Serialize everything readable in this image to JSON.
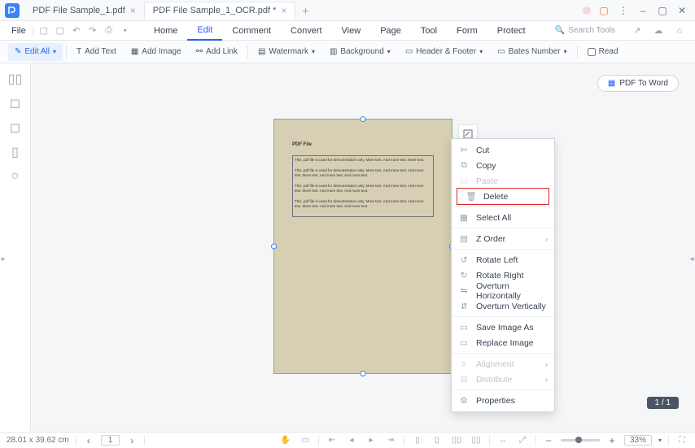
{
  "titlebar": {
    "tabs": [
      {
        "label": "PDF File Sample_1.pdf"
      },
      {
        "label": "PDF File Sample_1_OCR.pdf *"
      }
    ],
    "window_controls": {
      "min": "–",
      "max": "▢",
      "close": "✕"
    }
  },
  "menubar": {
    "file": "File",
    "items": [
      "Home",
      "Edit",
      "Comment",
      "Convert",
      "View",
      "Page",
      "Tool",
      "Form",
      "Protect"
    ],
    "active_index": 1,
    "search_placeholder": "Search Tools"
  },
  "ribbon": {
    "edit_all": "Edit All",
    "add_text": "Add Text",
    "add_image": "Add Image",
    "add_link": "Add Link",
    "watermark": "Watermark",
    "background": "Background",
    "header_footer": "Header & Footer",
    "bates_number": "Bates Number",
    "read": "Read"
  },
  "sidebar_icons": [
    "thumbnails",
    "bookmark",
    "comment",
    "attachment",
    "search"
  ],
  "pdf_to_word": "PDF To Word",
  "page": {
    "title": "PDF File",
    "p1": "This .pdf file is used for demonstration only. More text. And more text. More text.",
    "p2": "This .pdf file is used for demonstration only. More text. And more text. And more text. More text. And more text. And more text.",
    "p3": "This .pdf file is used for demonstration only. More text. And more text. And more text. More text. And more text. And more text.",
    "p4": "This .pdf file is used for demonstration only. More text. And more text. And more text. More text. And more text. And more text."
  },
  "context_menu": {
    "cut": "Cut",
    "copy": "Copy",
    "paste": "Paste",
    "delete": "Delete",
    "select_all": "Select All",
    "z_order": "Z Order",
    "rotate_left": "Rotate Left",
    "rotate_right": "Rotate Right",
    "overturn_h": "Overturn Horizontally",
    "overturn_v": "Overturn Vertically",
    "save_image_as": "Save Image As",
    "replace_image": "Replace Image",
    "alignment": "Alignment",
    "distribute": "Distribute",
    "properties": "Properties"
  },
  "page_pill": "1 / 1",
  "statusbar": {
    "dims": "28.01 x 39.62 cm",
    "page": "1",
    "zoom": "33%"
  }
}
